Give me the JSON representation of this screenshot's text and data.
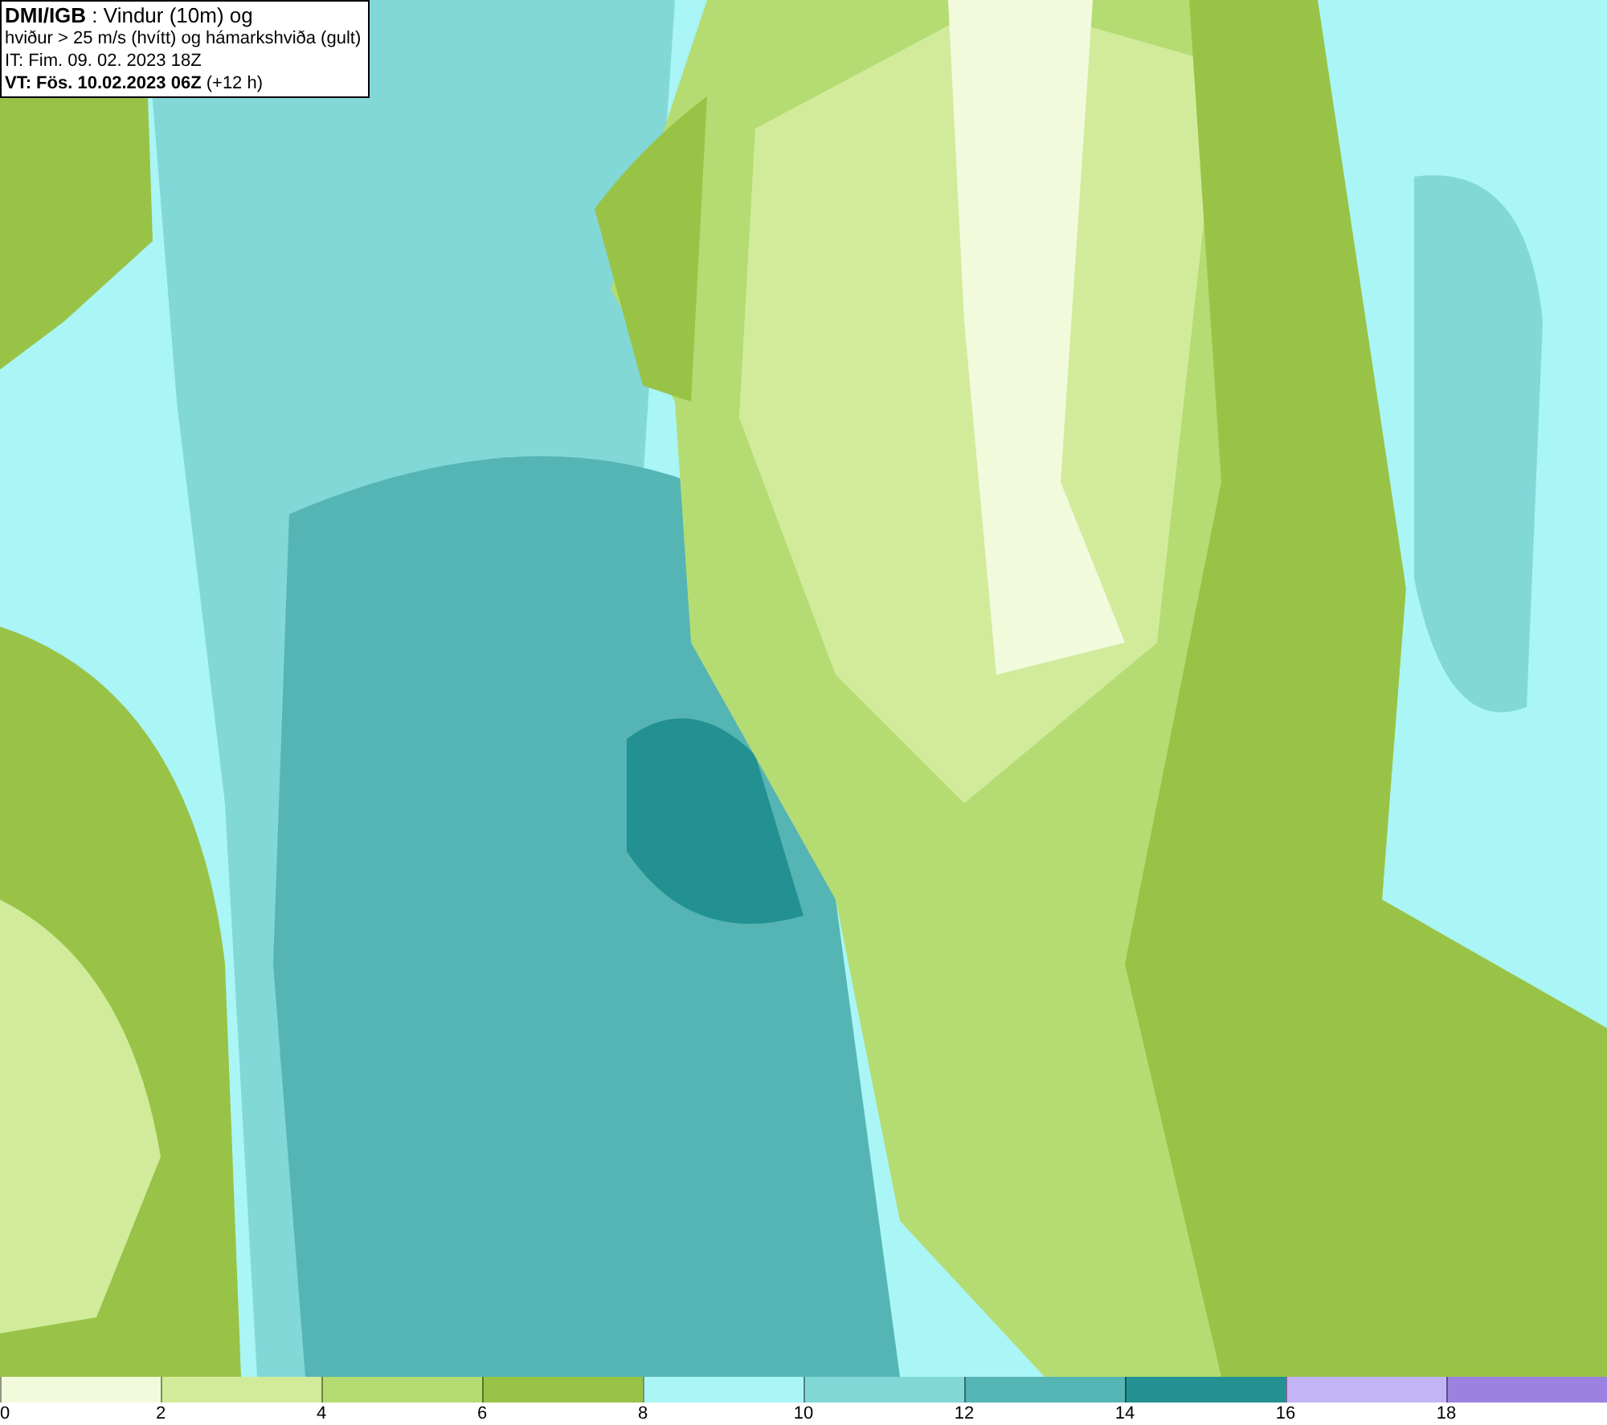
{
  "header": {
    "lines": [
      "**DMI/IGB** : Vindur (10m) og",
      "hviður > 25 m/s (hvítt) og hámarkshviða (gult)",
      "IT: Fim. 09. 02. 2023 18Z",
      "**VT: Fös. 10.02.2023 06Z** (+12 h)"
    ]
  },
  "legend": {
    "bins": [
      {
        "color": "#f2fadc",
        "label": "0"
      },
      {
        "color": "#d2eb9b",
        "label": "2"
      },
      {
        "color": "#b4dc73",
        "label": "4"
      },
      {
        "color": "#98c346",
        "label": "6"
      },
      {
        "color": "#aaf5f5",
        "label": "8"
      },
      {
        "color": "#82d7d7",
        "label": "10"
      },
      {
        "color": "#55b4b4",
        "label": "12"
      },
      {
        "color": "#239191",
        "label": "14"
      },
      {
        "color": "#c3b4f5",
        "label": "16"
      },
      {
        "color": "#9b82e1",
        "label": "18"
      }
    ]
  }
}
